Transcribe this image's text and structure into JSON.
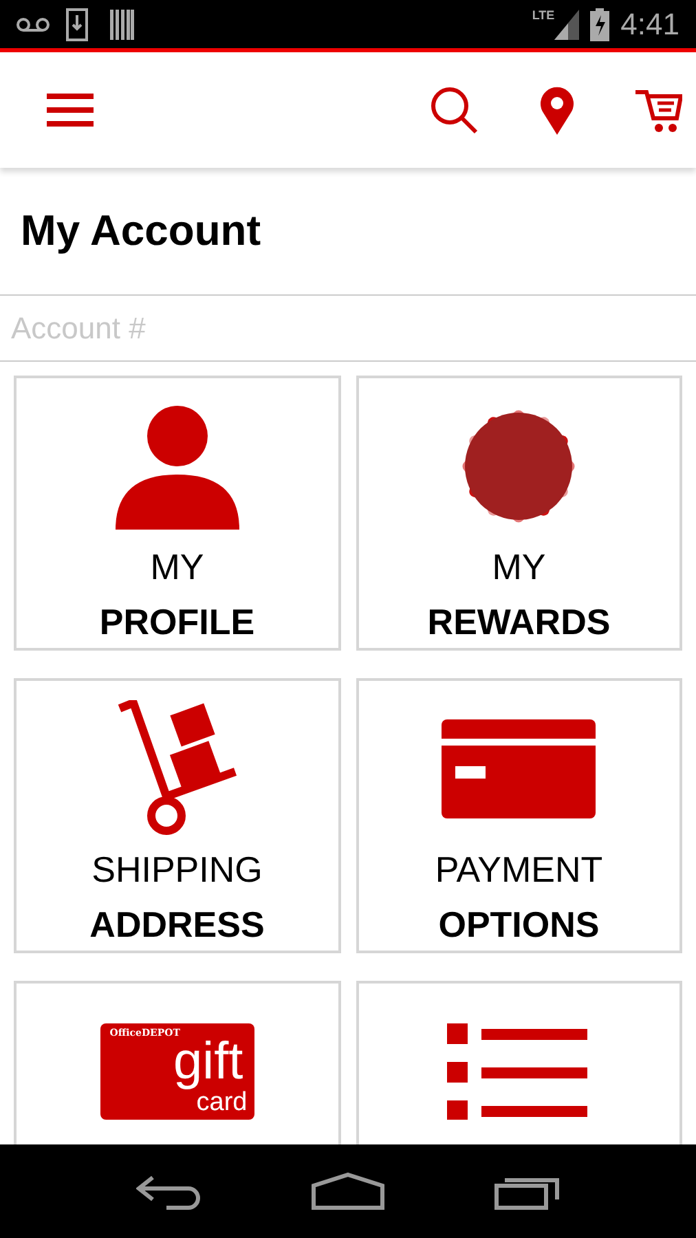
{
  "status_bar": {
    "time": "4:41",
    "network": "LTE"
  },
  "page": {
    "title": "My Account"
  },
  "account_field": {
    "placeholder": "Account #"
  },
  "tiles": [
    {
      "kind": "profile",
      "line1": "MY",
      "line2": "PROFILE"
    },
    {
      "kind": "rewards",
      "line1": "MY",
      "line2": "REWARDS"
    },
    {
      "kind": "shipping",
      "line1": "SHIPPING",
      "line2": "ADDRESS"
    },
    {
      "kind": "payment",
      "line1": "PAYMENT",
      "line2": "OPTIONS"
    },
    {
      "kind": "giftcard",
      "brand": "OfficeDEPOT",
      "word1": "gift",
      "word2": "card"
    },
    {
      "kind": "list"
    }
  ]
}
